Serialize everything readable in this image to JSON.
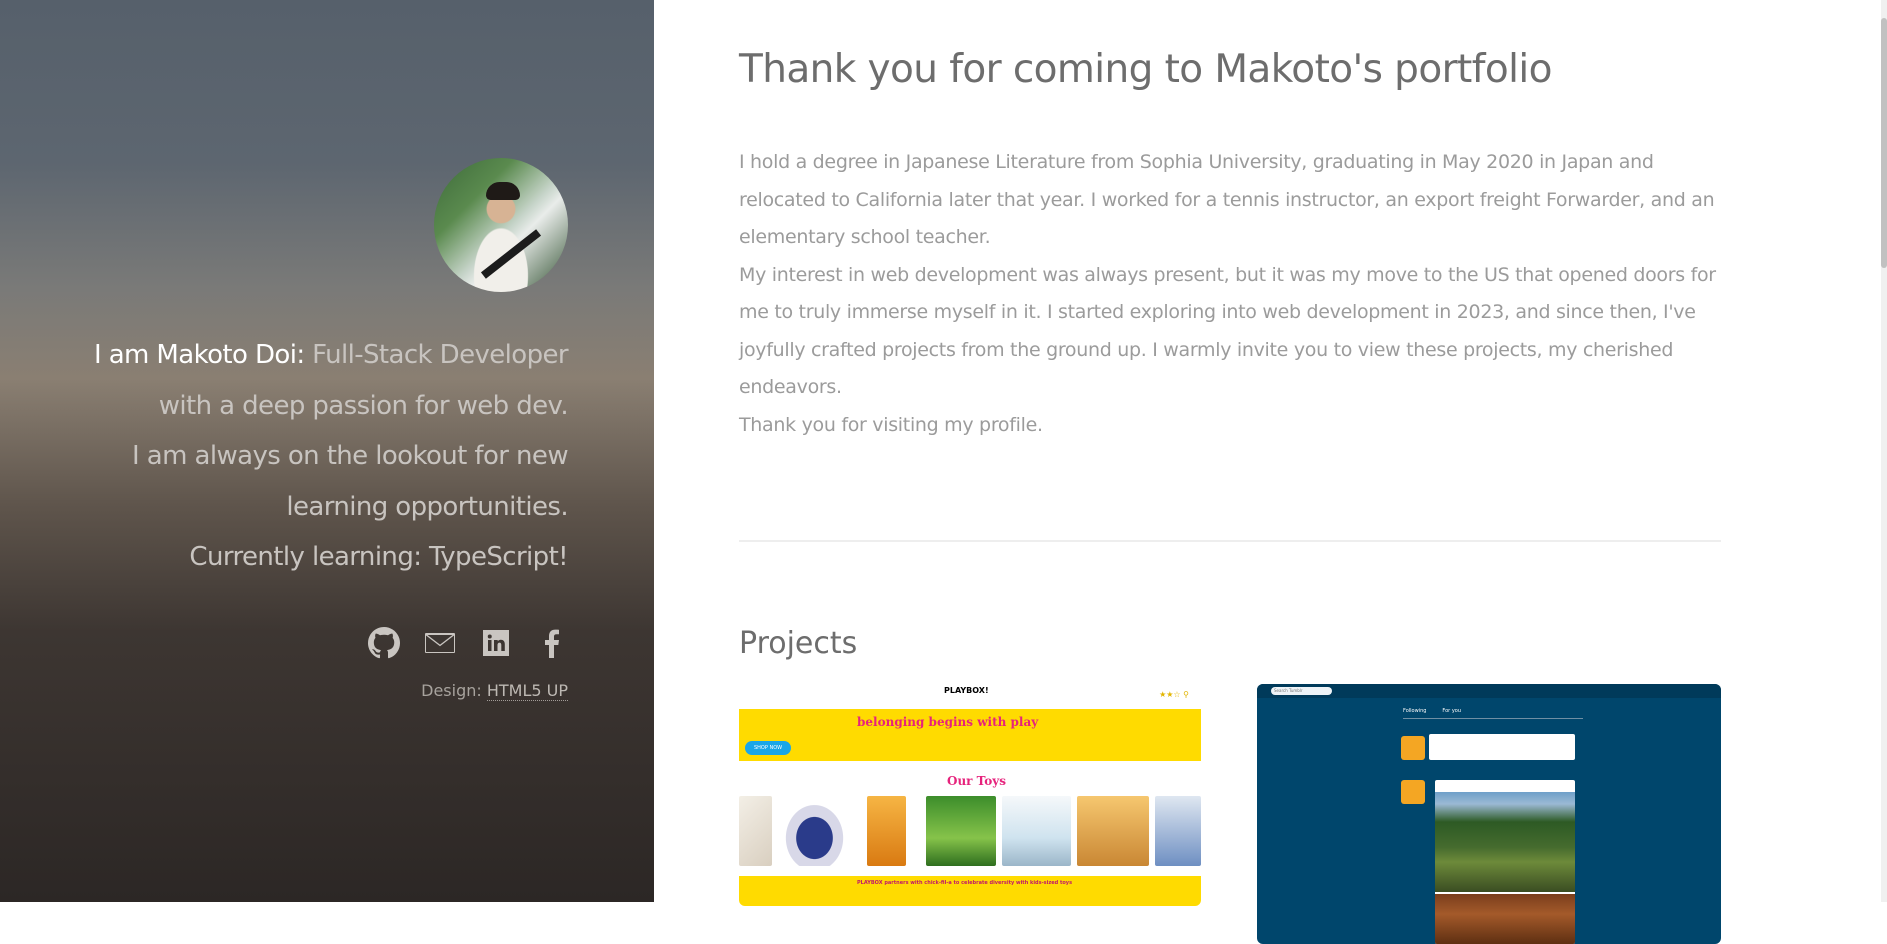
{
  "sidebar": {
    "avatar_alt": "Makoto Doi profile photo",
    "intro_name": "I am Makoto Doi:",
    "intro_rest": " Full-Stack Developer with a deep passion for web dev.",
    "intro_line3": "I am always on the lookout for new learning opportunities.",
    "intro_line4": "Currently learning: TypeScript!",
    "social": [
      {
        "icon": "github-icon"
      },
      {
        "icon": "email-icon"
      },
      {
        "icon": "linkedin-icon"
      },
      {
        "icon": "facebook-icon"
      }
    ],
    "credit_label": "Design: ",
    "credit_link": "HTML5 UP"
  },
  "main": {
    "title": "Thank you for coming to Makoto's portfolio",
    "about_p1": "I hold a degree in Japanese Literature from Sophia University, graduating in May 2020 in Japan and relocated to California later that year. I worked for a tennis instructor, an export freight Forwarder, and an elementary school teacher.",
    "about_p2": "My interest in web development was always present, but it was my move to the US that opened doors for me to truly immerse myself in it. I started exploring into web development in 2023, and since then, I've joyfully crafted projects from the ground up. I warmly invite you to view these projects, my cherished endeavors.",
    "about_p3": "Thank you for visiting my profile.",
    "projects_title": "Projects",
    "projects": [
      {
        "logo": "PLAYBOX!",
        "banner_title": "belonging begins with play",
        "shop_label": "SHOP NOW",
        "section_title": "Our Toys",
        "footer_text": "PLAYBOX partners with chick-fil-a to celebrate diversity with kids-sized toys"
      },
      {
        "search_placeholder": "Search Tumblr",
        "tab_following": "Following",
        "tab_for_you": "For you"
      }
    ]
  },
  "colors": {
    "accent_yellow": "#ffdb00",
    "accent_pink": "#e6237c",
    "tumblr_blue": "#00466c"
  }
}
